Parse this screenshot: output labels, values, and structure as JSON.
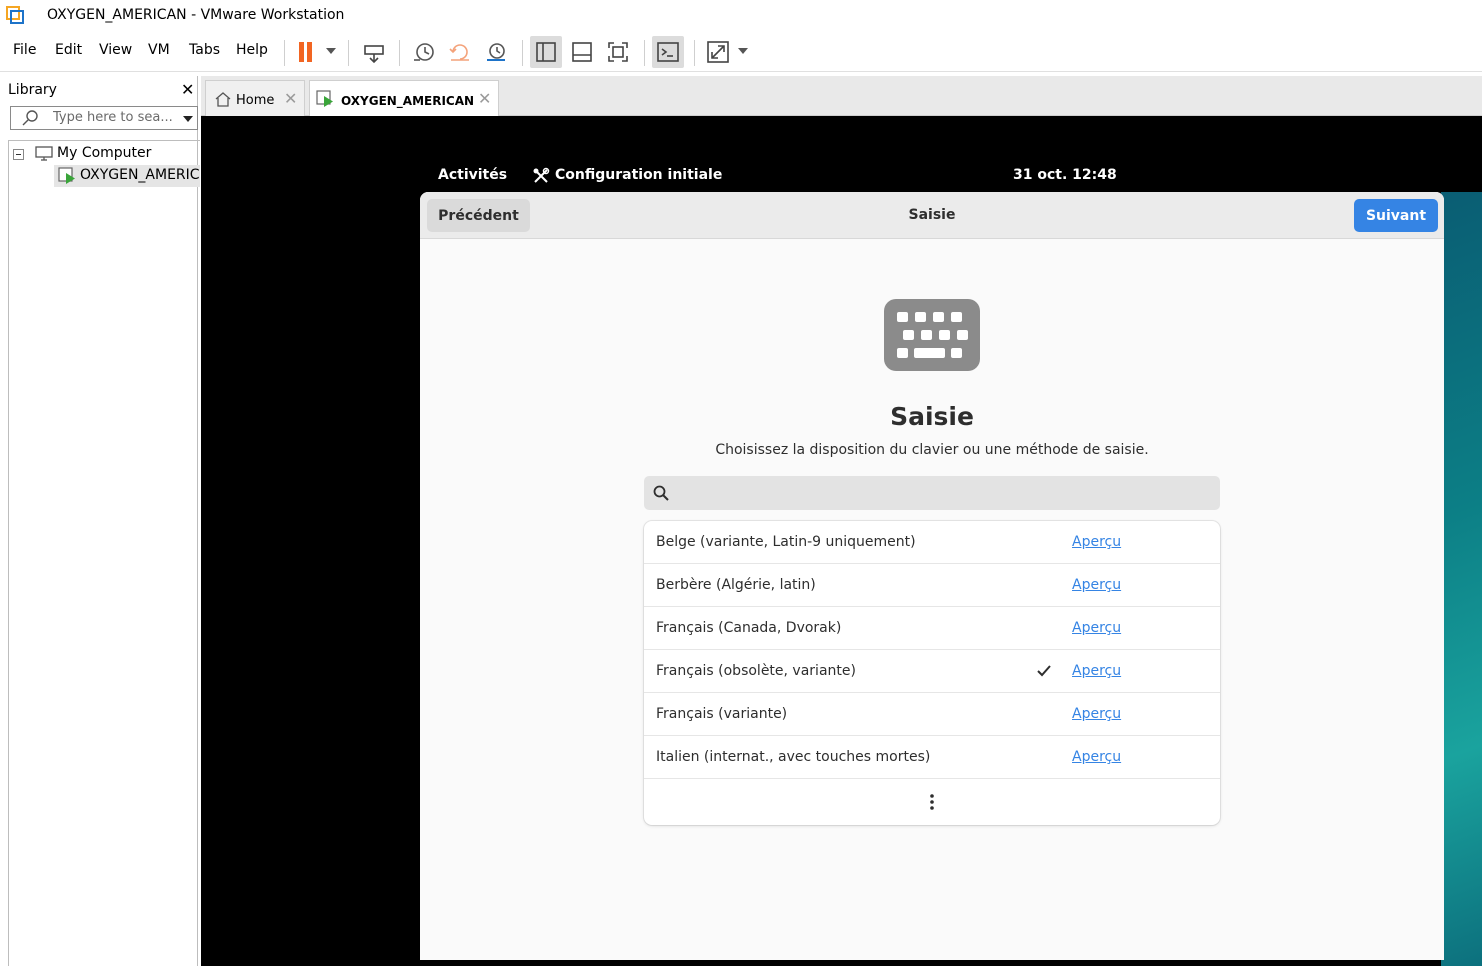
{
  "window": {
    "title": "OXYGEN_AMERICAN - VMware Workstation"
  },
  "menubar": {
    "items": [
      {
        "label": "File"
      },
      {
        "label": "Edit"
      },
      {
        "label": "View"
      },
      {
        "label": "VM"
      },
      {
        "label": "Tabs"
      },
      {
        "label": "Help"
      }
    ]
  },
  "toolbar": {
    "icons": [
      "pause-icon",
      "send-ctrl-alt-del-icon",
      "snapshot-take-icon",
      "snapshot-revert-icon",
      "snapshot-manager-icon",
      "show-library-icon",
      "show-thumbnail-bar-icon",
      "full-screen-icon",
      "console-view-icon",
      "stretch-guest-icon"
    ],
    "accent_pause": "#f26522"
  },
  "library": {
    "title": "Library",
    "search_placeholder": "Type here to sea...",
    "tree": {
      "root_label": "My Computer",
      "vm_label": "OXYGEN_AMERIC"
    }
  },
  "tabs": [
    {
      "label": "Home",
      "active": false
    },
    {
      "label": "OXYGEN_AMERICAN",
      "active": true
    }
  ],
  "gnome_topbar": {
    "activities": "Activités",
    "app_name": "Configuration initiale",
    "clock": "31 oct.  12:48"
  },
  "setup": {
    "prev_button": "Précédent",
    "header_title": "Saisie",
    "next_button": "Suivant",
    "heading": "Saisie",
    "subtitle": "Choisissez la disposition du clavier ou une méthode de saisie.",
    "search_placeholder": "",
    "accent": "#3584e4",
    "layouts": [
      {
        "label": "Belge (variante, Latin-9 uniquement)",
        "selected": false,
        "preview": "Aperçu"
      },
      {
        "label": "Berbère (Algérie, latin)",
        "selected": false,
        "preview": "Aperçu"
      },
      {
        "label": "Français (Canada, Dvorak)",
        "selected": false,
        "preview": "Aperçu"
      },
      {
        "label": "Français (obsolète, variante)",
        "selected": true,
        "preview": "Aperçu"
      },
      {
        "label": "Français (variante)",
        "selected": false,
        "preview": "Aperçu"
      },
      {
        "label": "Italien (internat., avec touches mortes)",
        "selected": false,
        "preview": "Aperçu"
      }
    ]
  }
}
